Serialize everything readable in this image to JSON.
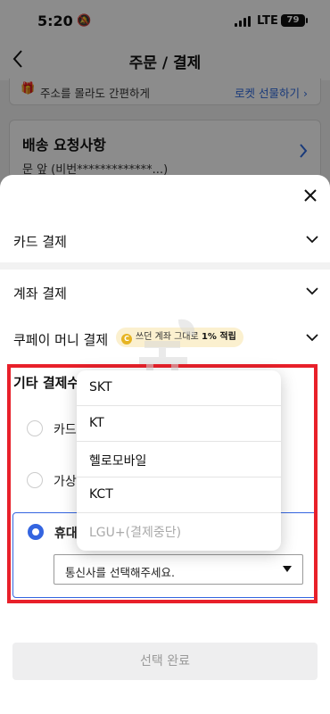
{
  "status_bar": {
    "time": "5:20",
    "network": "LTE",
    "battery": "79"
  },
  "header": {
    "title": "주문 / 결제"
  },
  "gift_banner": {
    "text": "주소를 몰라도 간편하게",
    "link": "로켓 선물하기 ›"
  },
  "delivery_request": {
    "title": "배송 요청사항",
    "value": "문 앞 (비번*************...)"
  },
  "sheet": {
    "rows": [
      {
        "label": "카드 결제"
      },
      {
        "label": "계좌 결제"
      },
      {
        "label": "쿠페이 머니 결제"
      }
    ],
    "badge": {
      "coin": "C",
      "text_prefix": "쓰던 계좌 그대로 ",
      "text_bold": "1% 적립"
    },
    "other": {
      "title": "기타 결제수",
      "options": [
        {
          "label": "카드",
          "selected": false
        },
        {
          "label": "가상",
          "selected": false
        },
        {
          "label": "휴대",
          "selected": true
        }
      ],
      "carrier_select": {
        "value": "통신사를 선택해주세요."
      }
    },
    "carrier_dropdown": {
      "items": [
        {
          "label": "SKT",
          "disabled": false
        },
        {
          "label": "KT",
          "disabled": false
        },
        {
          "label": "헬로모바일",
          "disabled": false
        },
        {
          "label": "KCT",
          "disabled": false
        },
        {
          "label": "LGU+(결제중단)",
          "disabled": true
        }
      ]
    },
    "confirm_button": {
      "label": "선택 완료"
    }
  },
  "colors": {
    "accent": "#3465e0",
    "highlight_frame": "#e8202a",
    "badge_bg": "#fbf0cf"
  }
}
